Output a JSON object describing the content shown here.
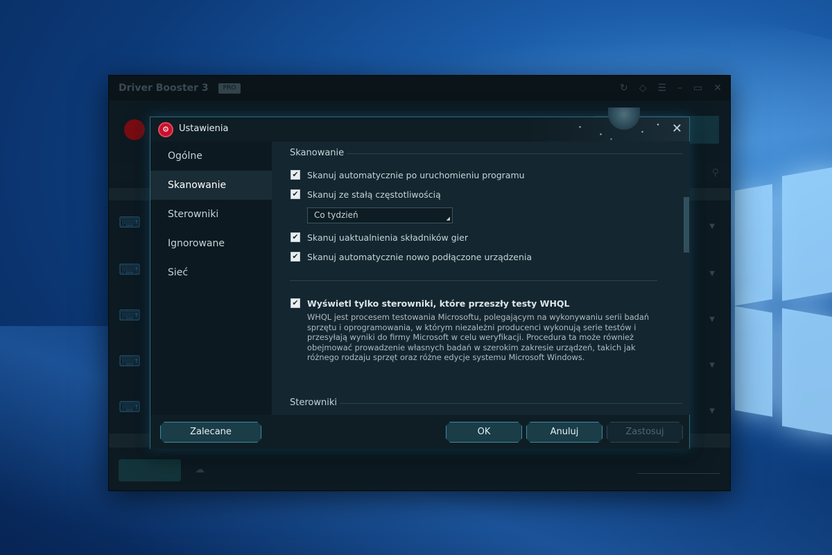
{
  "background_app": {
    "title": "Driver Booster 3",
    "edition_badge": "PRO"
  },
  "dialog": {
    "title": "Ustawienia",
    "sidebar": [
      {
        "label": "Ogólne",
        "active": false
      },
      {
        "label": "Skanowanie",
        "active": true
      },
      {
        "label": "Sterowniki",
        "active": false
      },
      {
        "label": "Ignorowane",
        "active": false
      },
      {
        "label": "Sieć",
        "active": false
      }
    ],
    "section_scan": "Skanowanie",
    "options": [
      {
        "label": "Skanuj automatycznie po uruchomieniu programu",
        "checked": true
      },
      {
        "label": "Skanuj ze stałą częstotliwością",
        "checked": true
      },
      {
        "label": "Skanuj uaktualnienia składników gier",
        "checked": true
      },
      {
        "label": "Skanuj automatycznie nowo podłączone urządzenia",
        "checked": true
      }
    ],
    "frequency_select": {
      "value": "Co tydzień"
    },
    "whql": {
      "label": "Wyświetl tylko sterowniki, które przeszły testy WHQL",
      "checked": true,
      "description_lines": [
        "WHQL jest procesem testowania Microsoftu, polegającym na wykonywaniu serii badań",
        "sprzętu i oprogramowania, w którym niezależni producenci wykonują serie testów i",
        "przesyłają wyniki do firmy Microsoft w celu weryfikacji. Procedura ta może również",
        "obejmować prowadzenie własnych badań w szerokim zakresie urządzeń, takich jak",
        "różnego rodzaju sprzęt oraz różne edycje systemu Microsoft Windows."
      ]
    },
    "section_drivers": "Sterowniki",
    "buttons": {
      "recommended": "Zalecane",
      "ok": "OK",
      "cancel": "Anuluj",
      "apply": "Zastosuj"
    },
    "colors": {
      "accent": "#3f8ba1",
      "dialog_bg": "#14262f",
      "sidebar_bg": "#0c1920",
      "brand_red": "#c8102e"
    }
  }
}
